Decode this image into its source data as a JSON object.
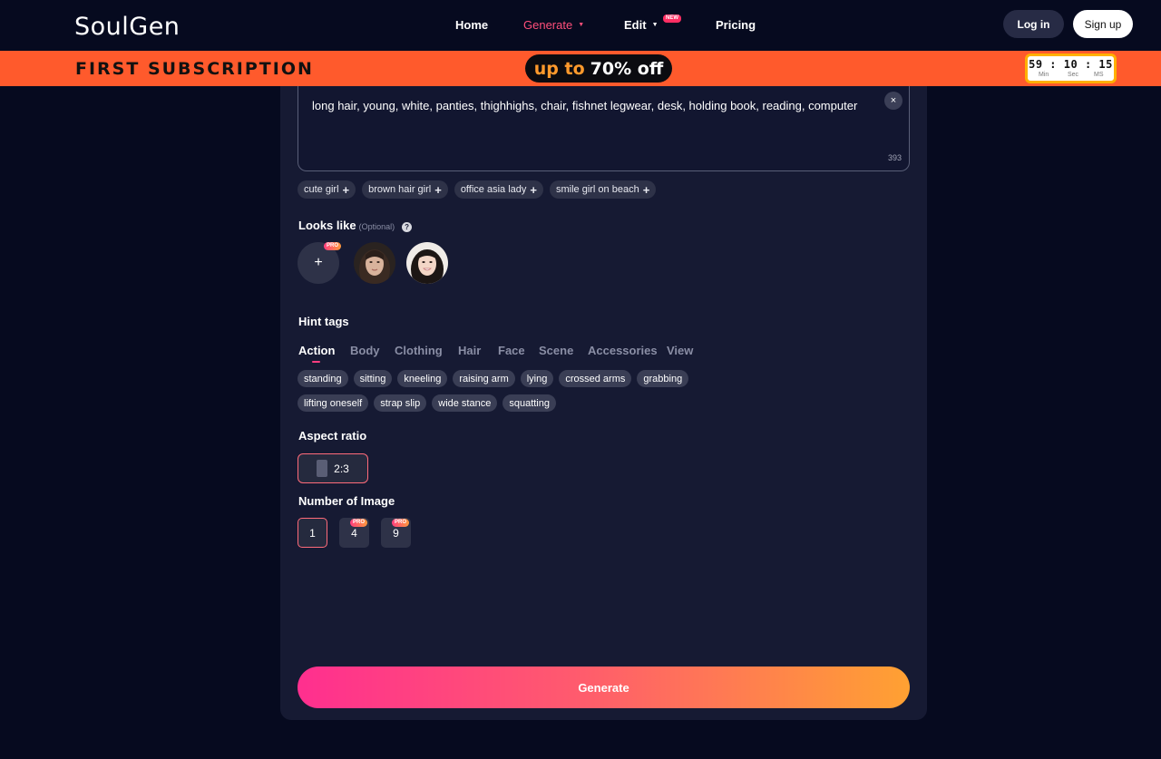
{
  "header": {
    "logo": "SoulGen",
    "nav": [
      {
        "label": "Home"
      },
      {
        "label": "Generate",
        "active": true
      },
      {
        "label": "Edit",
        "badge": "NEW"
      },
      {
        "label": "Pricing"
      }
    ],
    "login_label": "Log in",
    "signup_label": "Sign up"
  },
  "promo": {
    "title": "FIRST SUBSCRIPTION",
    "upto": "up to",
    "discount": "70% off",
    "timer": {
      "min": "59",
      "sec": "10",
      "ms": "15",
      "min_label": "Min",
      "sec_label": "Sec",
      "ms_label": "MS"
    }
  },
  "prompt": {
    "text": "long hair, young, white, panties, thighhighs, chair, fishnet legwear, desk, holding book, reading, computer",
    "count": "393",
    "clear_label": "×"
  },
  "suggestions": [
    "cute girl",
    "brown hair girl",
    "office asia lady",
    "smile girl on beach"
  ],
  "looks_like": {
    "title": "Looks like",
    "optional": "(Optional)",
    "help": "?",
    "add_label": "+",
    "pro": "PRO"
  },
  "hint_tags": {
    "title": "Hint tags",
    "tabs": [
      "Action",
      "Body",
      "Clothing",
      "Hair",
      "Face",
      "Scene",
      "Accessories",
      "View"
    ],
    "active_tab": "Action",
    "row1": [
      "standing",
      "sitting",
      "kneeling",
      "raising arm",
      "lying",
      "crossed arms",
      "grabbing"
    ],
    "row2": [
      "lifting oneself",
      "strap slip",
      "wide stance",
      "squatting"
    ]
  },
  "aspect_ratio": {
    "title": "Aspect ratio",
    "value": "2:3"
  },
  "number_of_image": {
    "title": "Number of Image",
    "options": [
      {
        "label": "1",
        "selected": true
      },
      {
        "label": "4",
        "pro": "PRO"
      },
      {
        "label": "9",
        "pro": "PRO"
      }
    ]
  },
  "generate_label": "Generate",
  "colors": {
    "background": "#060a1f",
    "panel": "#161a33",
    "promo": "#ff5a2c",
    "accent": "#ff3d7f"
  }
}
